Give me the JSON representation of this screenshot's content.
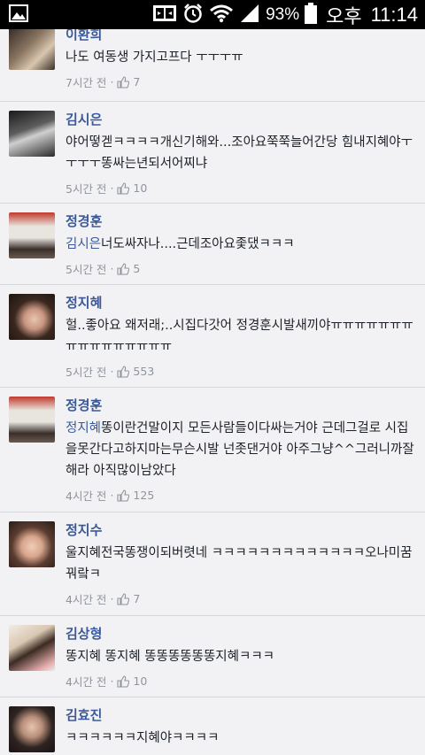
{
  "status_bar": {
    "battery_percent": "93%",
    "ampm": "오후",
    "time": "11:14",
    "icons": [
      "gallery-icon",
      "screen-mirror-icon",
      "alarm-icon",
      "wifi-icon",
      "signal-icon",
      "battery-icon"
    ]
  },
  "comments": [
    {
      "name": "이환희",
      "text": "나도 여동생 가지고프다 ㅜㅜㅜㅠ",
      "mention": "",
      "time": "7시간 전",
      "likes": "7",
      "avatar_color": "#6b5a4a"
    },
    {
      "name": "김시은",
      "text": "야어떻겓ㅋㅋㅋㅋ개신기해와...조아요쭉쭉늘어간당 힘내지혜야ㅜㅜㅜㅜ똥싸는년되서어찌냐",
      "mention": "",
      "time": "5시간 전",
      "likes": "10",
      "avatar_color": "#3a3a3a"
    },
    {
      "name": "정경훈",
      "text": "너도싸자나....근데조아요좇댔ㅋㅋㅋ",
      "mention": "김시은",
      "time": "5시간 전",
      "likes": "5",
      "avatar_color": "#b5453d"
    },
    {
      "name": "정지혜",
      "text": "헐..좋아요 왜저래;..시집다갓어 정경훈시발새끼야ㅠㅠㅠㅠㅠㅠㅠㅠㅠㅠㅠㅠㅠㅠㅠㅠ",
      "mention": "",
      "time": "5시간 전",
      "likes": "553",
      "avatar_color": "#4a3328"
    },
    {
      "name": "정경훈",
      "text": "똥이란건말이지 모든사람들이다싸는거야 근데그걸로 시집을못간다고하지마는무슨시발 넌좃댄거야 아주그냥^^그러니까잘해라 아직많이남았다",
      "mention": "정지혜",
      "time": "4시간 전",
      "likes": "125",
      "avatar_color": "#b5453d"
    },
    {
      "name": "정지수",
      "text": "울지혜전국똥쟁이되버렷네 ㅋㅋㅋㅋㅋㅋㅋㅋㅋㅋㅋㅋㅋ오나미꿈꿔랔ㅋ",
      "mention": "",
      "time": "4시간 전",
      "likes": "7",
      "avatar_color": "#5a4034"
    },
    {
      "name": "김상형",
      "text": "똥지혜 똥지혜 똥똥똥똥똥똥지혜ㅋㅋㅋ",
      "mention": "",
      "time": "4시간 전",
      "likes": "10",
      "avatar_color": "#c9b9a6"
    },
    {
      "name": "김효진",
      "text": "ㅋㅋㅋㅋㅋㅋ지혜야ㅋㅋㅋㅋ",
      "mention": "",
      "time": "",
      "likes": "",
      "avatar_color": "#3d3432"
    }
  ]
}
